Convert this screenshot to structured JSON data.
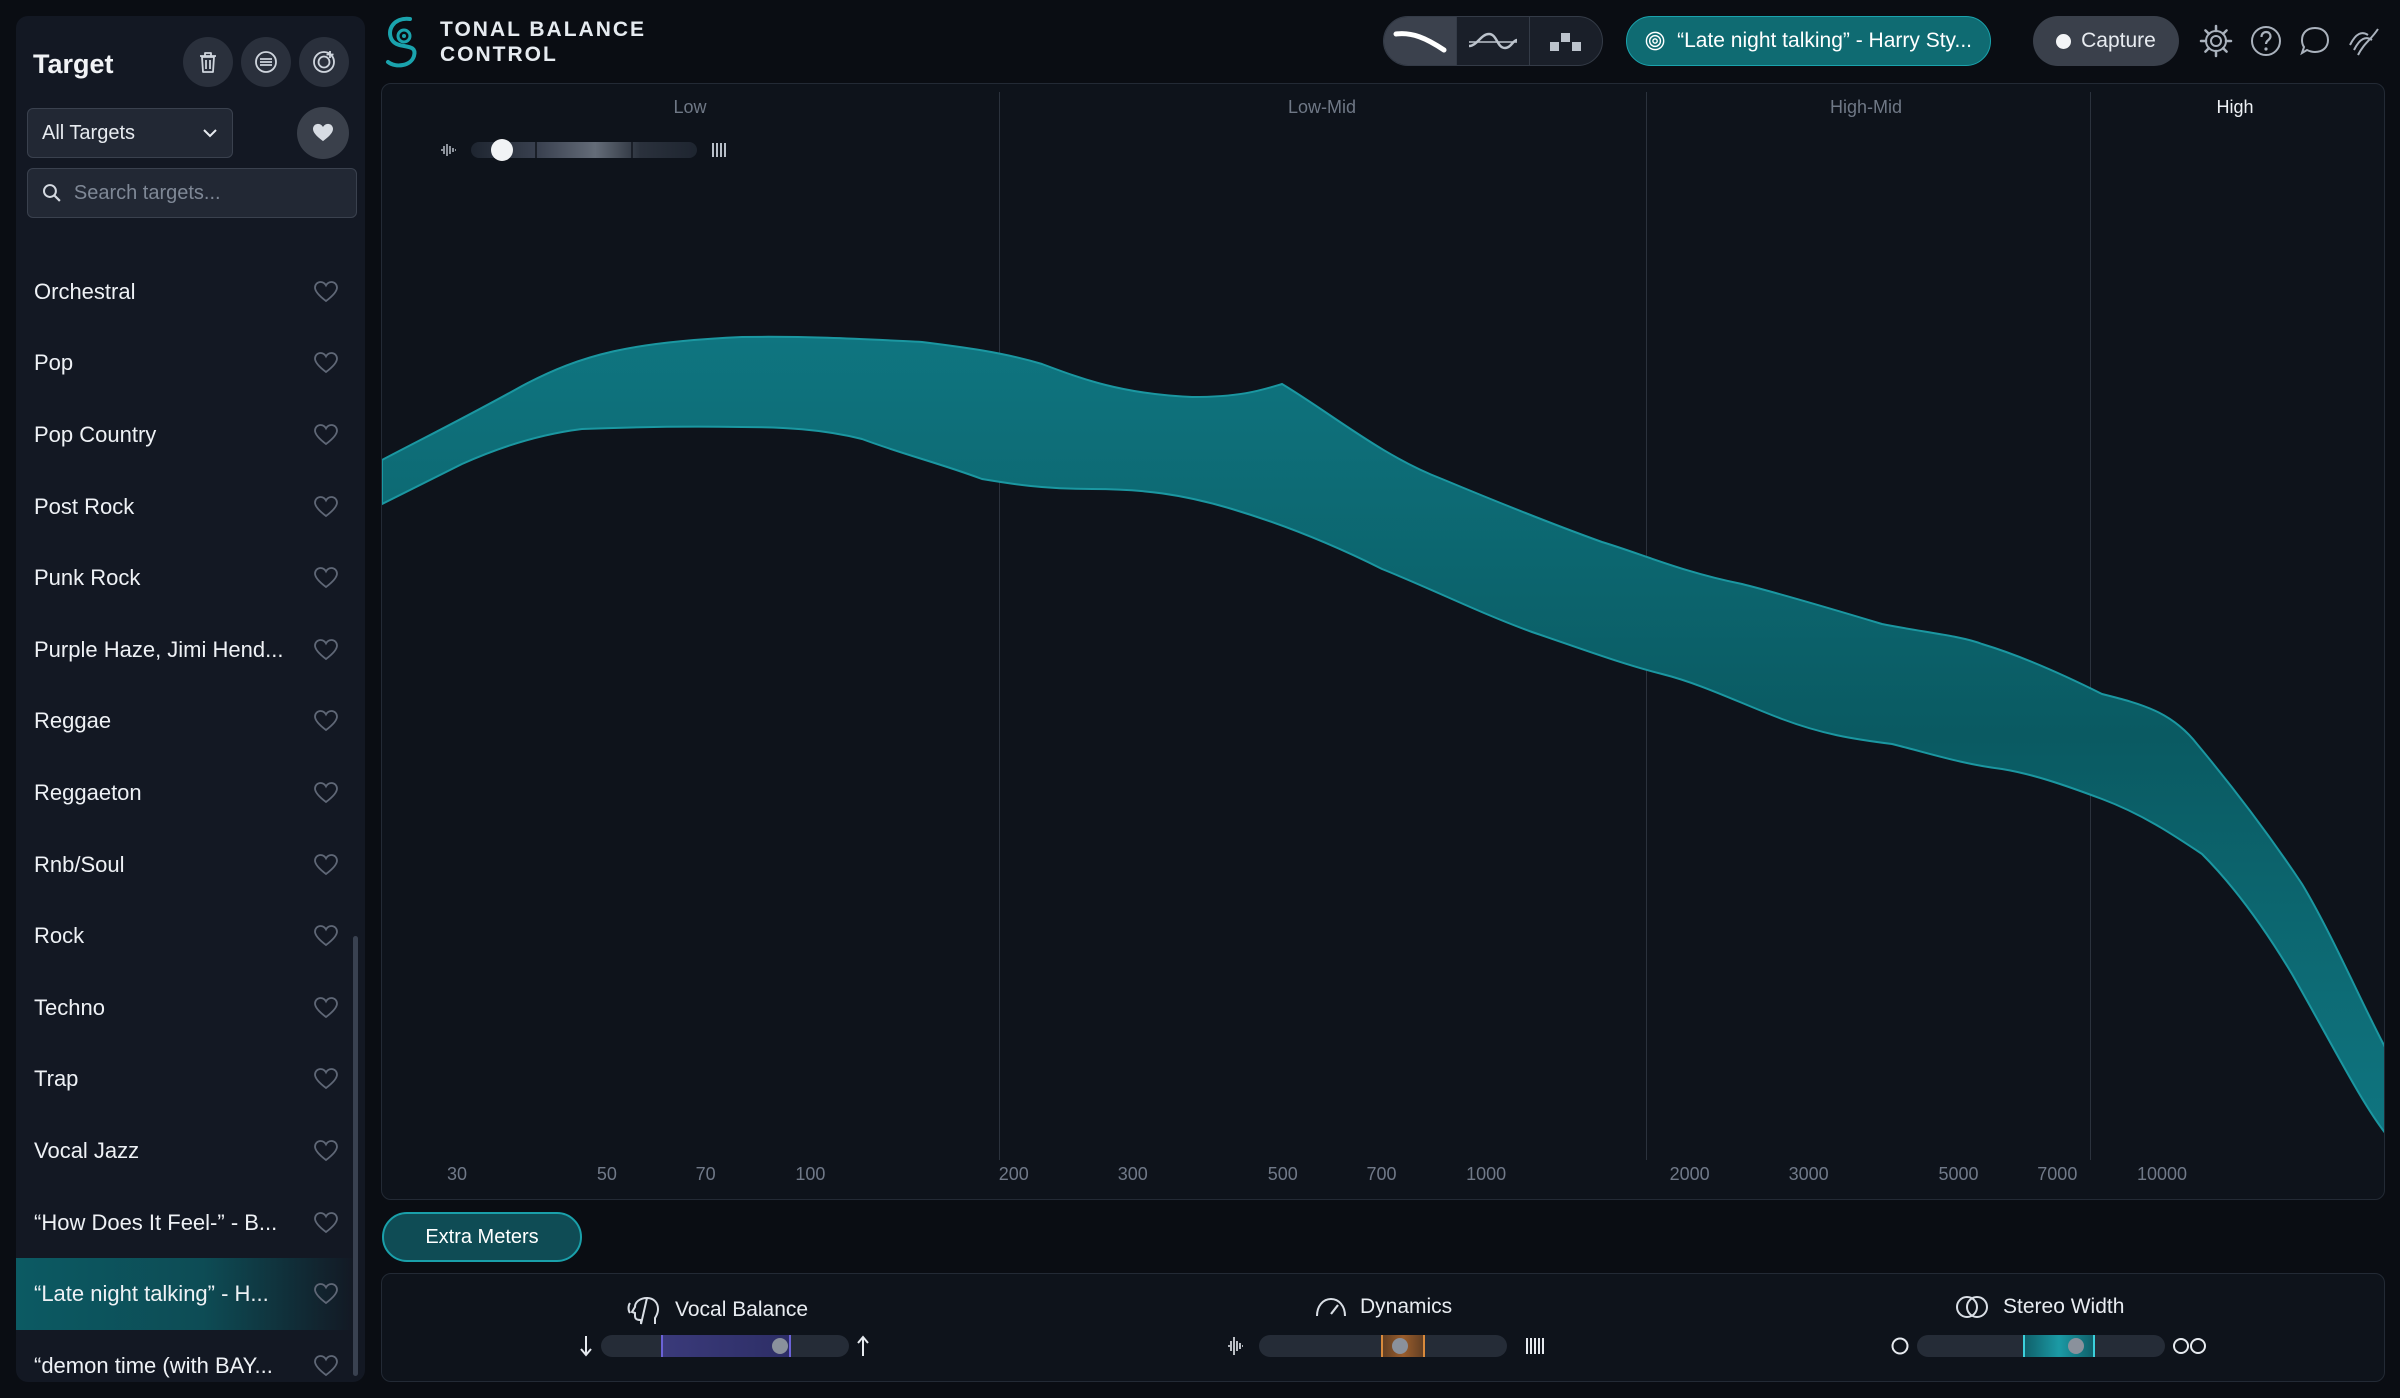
{
  "sidebar": {
    "title": "Target",
    "dropdown_value": "All Targets",
    "search_placeholder": "Search targets...",
    "items": [
      {
        "label": "Orchestral"
      },
      {
        "label": "Pop"
      },
      {
        "label": "Pop Country"
      },
      {
        "label": "Post Rock"
      },
      {
        "label": "Punk Rock"
      },
      {
        "label": "Purple Haze, Jimi Hend..."
      },
      {
        "label": "Reggae"
      },
      {
        "label": "Reggaeton"
      },
      {
        "label": "Rnb/Soul"
      },
      {
        "label": "Rock"
      },
      {
        "label": "Techno"
      },
      {
        "label": "Trap"
      },
      {
        "label": "Vocal Jazz"
      },
      {
        "label": "“How Does It Feel-” - B..."
      },
      {
        "label": "“Late night talking” - H..."
      },
      {
        "label": "“demon time (with BAY..."
      }
    ],
    "selected_index": 14
  },
  "header": {
    "logo_line1": "TONAL BALANCE",
    "logo_line2": "CONTROL",
    "active_view": "broadband",
    "target_label": "“Late night talking” - Harry Sty...",
    "capture_label": "Capture"
  },
  "graph": {
    "bands": [
      {
        "label": "Low",
        "active": false
      },
      {
        "label": "Low-Mid",
        "active": false
      },
      {
        "label": "High-Mid",
        "active": false
      },
      {
        "label": "High",
        "active": true
      }
    ],
    "freq_ticks": [
      "30",
      "50",
      "70",
      "100",
      "200",
      "300",
      "500",
      "700",
      "1000",
      "2000",
      "3000",
      "5000",
      "7000",
      "10000"
    ],
    "smoothing_level": 0.1,
    "colors": {
      "curve": "#0e6f79",
      "curve_core": "#0b5c64",
      "curve_edge": "#1b97a1"
    }
  },
  "extra_meters_label": "Extra Meters",
  "meters": {
    "vocal_balance": {
      "label": "Vocal Balance",
      "indicator": 0.72
    },
    "dynamics": {
      "label": "Dynamics",
      "indicator": 0.57
    },
    "stereo_width": {
      "label": "Stereo Width",
      "indicator": 0.64
    }
  }
}
